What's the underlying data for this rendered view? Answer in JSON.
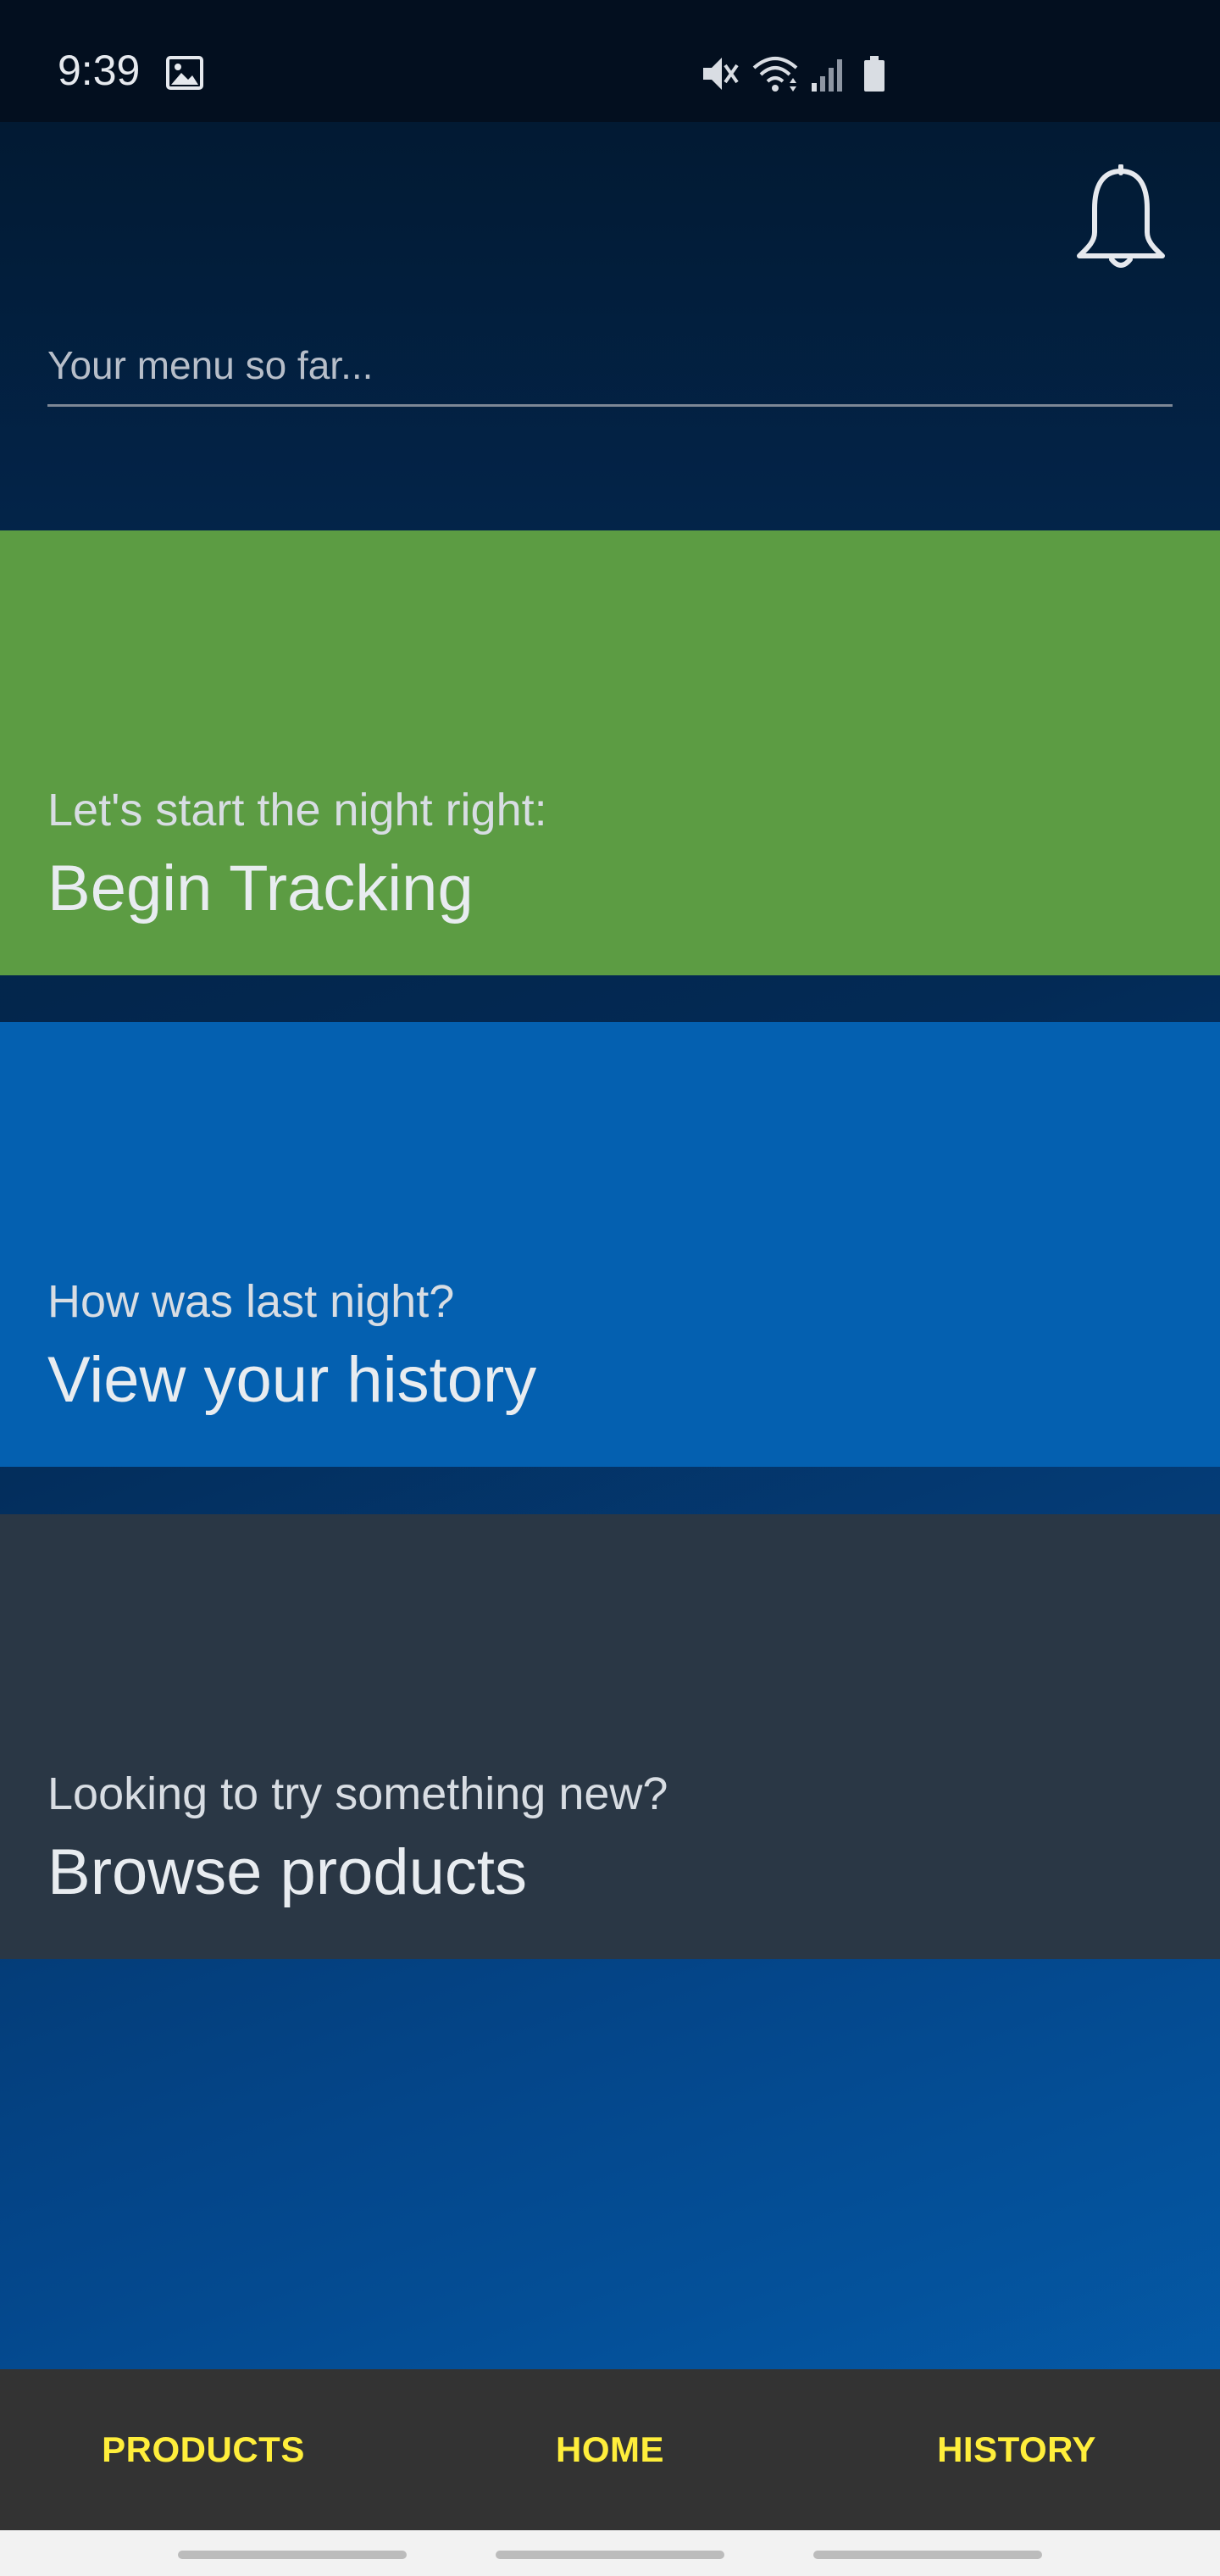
{
  "status_bar": {
    "time": "9:39",
    "icons": [
      "gallery-icon",
      "mute-icon",
      "wifi-icon",
      "signal-icon",
      "battery-icon"
    ]
  },
  "header": {
    "menu_placeholder": "Your menu so far...",
    "notification_icon": "bell-icon"
  },
  "cards": [
    {
      "subtitle": "Let's start the night right:",
      "title": "Begin Tracking",
      "color": "#5c9c43"
    },
    {
      "subtitle": "How was last night?",
      "title": "View your history",
      "color": "#0460b0"
    },
    {
      "subtitle": "Looking to try something new?",
      "title": "Browse products",
      "color": "#2a3745"
    }
  ],
  "bottom_nav": {
    "items": [
      {
        "label": "PRODUCTS"
      },
      {
        "label": "HOME"
      },
      {
        "label": "HISTORY"
      }
    ],
    "label_color": "#ffee3b",
    "background": "#333333"
  },
  "colors": {
    "status_bar": "#030f1f",
    "header": "#021a33",
    "accent_yellow": "#ffee3b"
  }
}
